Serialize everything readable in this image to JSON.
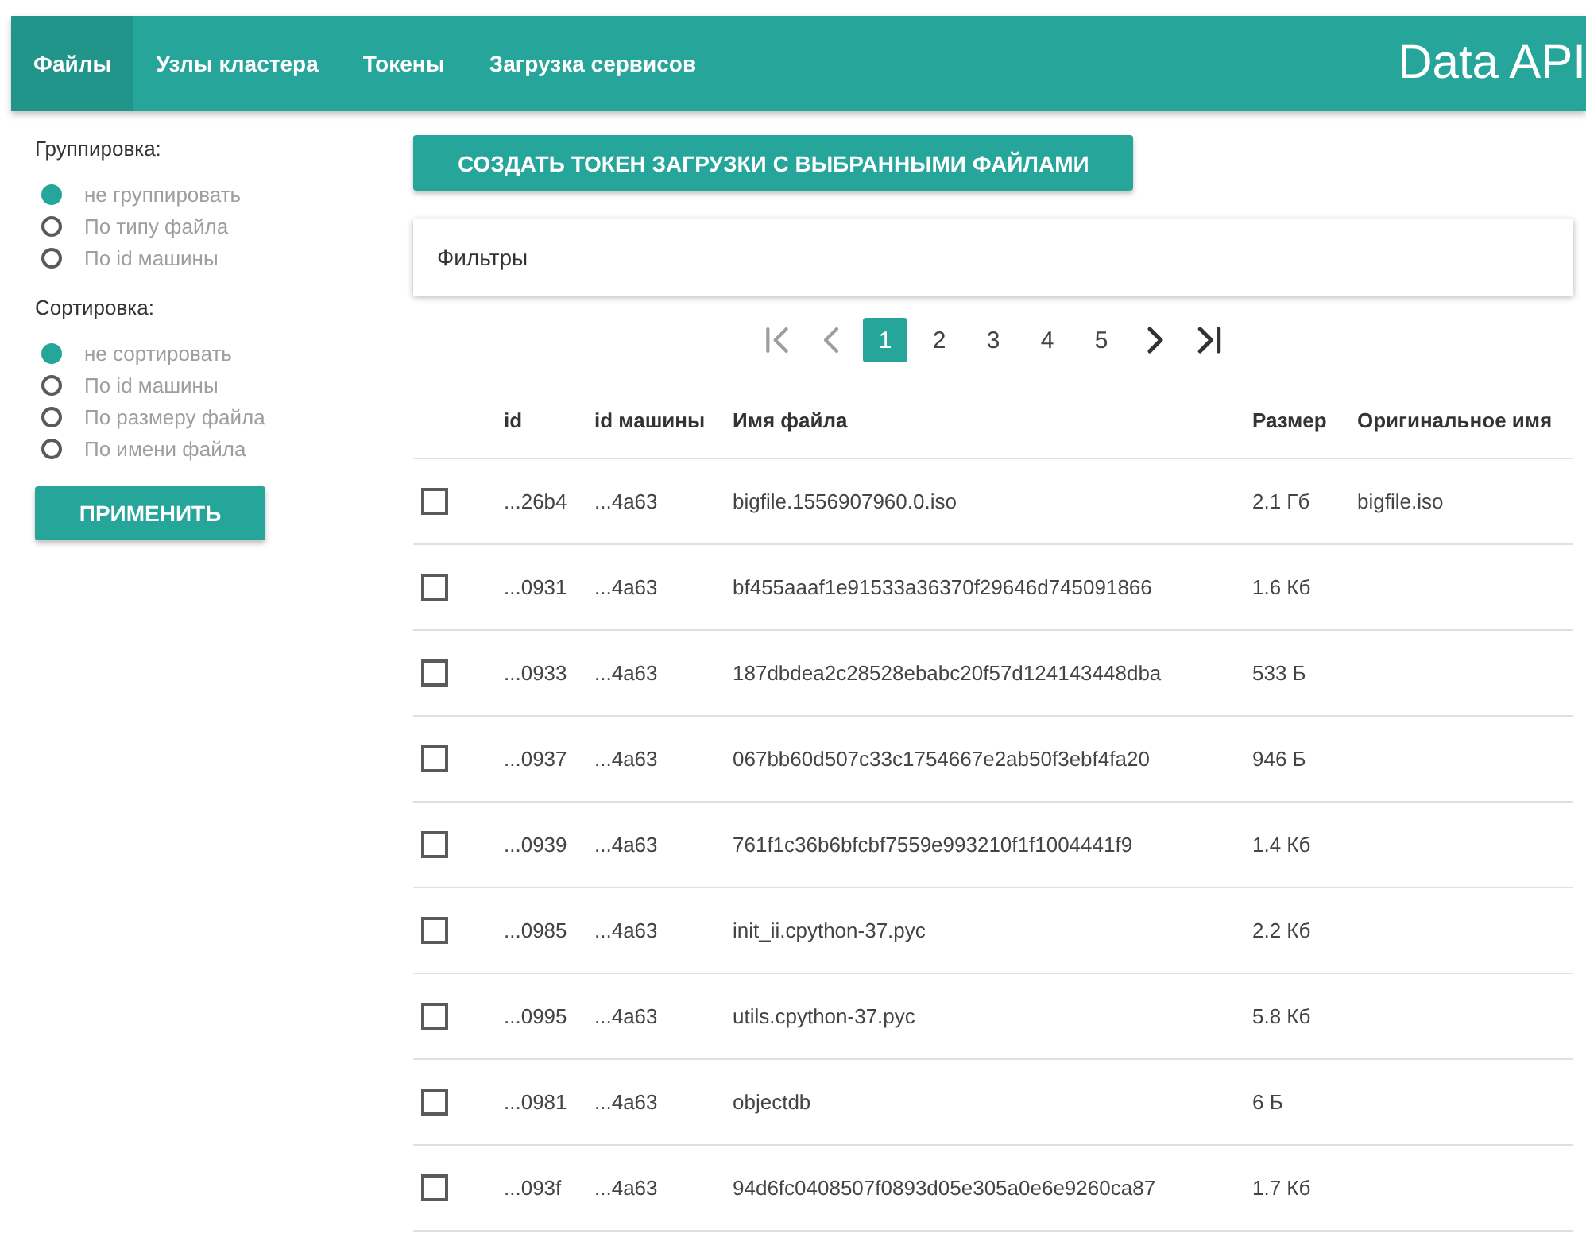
{
  "nav": {
    "tabs": [
      {
        "label": "Файлы",
        "selected": true
      },
      {
        "label": "Узлы кластера",
        "selected": false
      },
      {
        "label": "Токены",
        "selected": false
      },
      {
        "label": "Загрузка сервисов",
        "selected": false
      }
    ],
    "brand": "Data API"
  },
  "sidebar": {
    "groups": [
      {
        "title": "Группировка:",
        "options": [
          {
            "label": "не группировать",
            "selected": true
          },
          {
            "label": "По типу файла",
            "selected": false
          },
          {
            "label": "По id машины",
            "selected": false
          }
        ]
      },
      {
        "title": "Сортировка:",
        "options": [
          {
            "label": "не сортировать",
            "selected": true
          },
          {
            "label": "По id машины",
            "selected": false
          },
          {
            "label": "По размеру файла",
            "selected": false
          },
          {
            "label": "По имени файла",
            "selected": false
          }
        ]
      }
    ],
    "apply_button": "ПРИМЕНИТЬ"
  },
  "create_token_button": "СОЗДАТЬ ТОКЕН ЗАГРУЗКИ С ВЫБРАННЫМИ ФАЙЛАМИ",
  "filters": {
    "title": "Фильтры"
  },
  "pagination": {
    "first_disabled": true,
    "prev_disabled": true,
    "next_disabled": false,
    "last_disabled": false,
    "pages": [
      {
        "label": "1",
        "selected": true
      },
      {
        "label": "2",
        "selected": false
      },
      {
        "label": "3",
        "selected": false
      },
      {
        "label": "4",
        "selected": false
      },
      {
        "label": "5",
        "selected": false
      }
    ]
  },
  "table": {
    "columns": [
      "id",
      "id машины",
      "Имя файла",
      "Размер",
      "Оригинальное имя"
    ],
    "rows": [
      {
        "checked": false,
        "cells": [
          "...26b4",
          "...4a63",
          "bigfile.1556907960.0.iso",
          "2.1 Гб",
          "bigfile.iso"
        ]
      },
      {
        "checked": false,
        "cells": [
          "...0931",
          "...4a63",
          "bf455aaaf1e91533a36370f29646d745091866",
          "1.6 Кб"
        ]
      },
      {
        "checked": false,
        "cells": [
          "...0933",
          "...4a63",
          "187dbdea2c28528ebabc20f57d124143448dba",
          "533 Б"
        ]
      },
      {
        "checked": false,
        "cells": [
          "...0937",
          "...4a63",
          "067bb60d507c33c1754667e2ab50f3ebf4fa20",
          "946 Б"
        ]
      },
      {
        "checked": false,
        "cells": [
          "...0939",
          "...4a63",
          "761f1c36b6bfcbf7559e993210f1f1004441f9",
          "1.4 Кб"
        ]
      },
      {
        "checked": false,
        "cells": [
          "...0985",
          "...4a63",
          "init_ii.cpython-37.pyc",
          "2.2 Кб"
        ]
      },
      {
        "checked": false,
        "cells": [
          "...0995",
          "...4a63",
          "utils.cpython-37.pyc",
          "5.8 Кб"
        ]
      },
      {
        "checked": false,
        "cells": [
          "...0981",
          "...4a63",
          "objectdb",
          "6 Б"
        ]
      },
      {
        "checked": false,
        "cells": [
          "...093f",
          "...4a63",
          "94d6fc0408507f0893d05e305a0e6e9260ca87",
          "1.7 Кб"
        ]
      }
    ]
  }
}
